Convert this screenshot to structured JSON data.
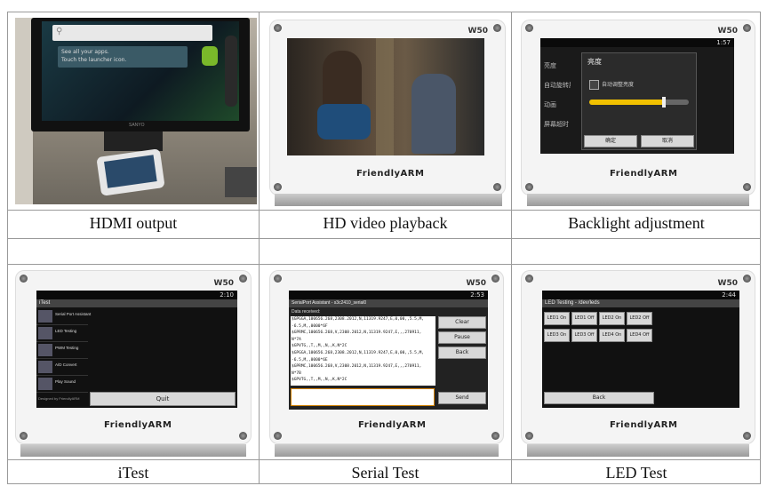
{
  "captions": [
    "HDMI output",
    "HD video playback",
    "Backlight adjustment",
    "iTest",
    "Serial Test",
    "LED Test"
  ],
  "board": {
    "brand": "FriendlyARM",
    "model": "W50"
  },
  "hdmi": {
    "search_text": "See all your apps.",
    "search_sub": "Touch the launcher icon.",
    "monitor_brand": "SANYO"
  },
  "backlight": {
    "time": "1:57",
    "dialog_title": "亮度",
    "auto_label": "自动调整亮度",
    "ok": "确定",
    "cancel": "取消",
    "brightness": 0.75,
    "menu": [
      "亮度",
      "自动旋转屏幕",
      "动画",
      "屏幕超时"
    ]
  },
  "itest": {
    "time": "2:10",
    "title": "iTest",
    "items": [
      "Serial Port Assistant",
      "LED Testing",
      "PWM Testing",
      "A/D Convert",
      "Play Sound"
    ],
    "footer": "Designed by FriendlyARM",
    "quit": "Quit"
  },
  "serial": {
    "time": "2:53",
    "title": "SerialPort Assistant - s3c2410_serial0",
    "received_label": "Data received:",
    "lines": [
      "$GPGGA,100656.268,2308.2012,N,11319.9247,E,0,00,,5.5,M,",
      "-6.5,M,,0000*6F",
      "$GPRMC,100656.268,V,2308.2012,N,11319.9247,E,,,270911,",
      "N*7A",
      "$GPVTG,,T,,M,,N,,K,N*2C",
      "$GPGGA,100656.268,2308.2012,N,11319.9247,E,0,00,,5.5,M,",
      "-6.5,M,,0000*6E",
      "$GPRMC,100656.268,V,2308.2012,N,11319.9247,E,,,270911,",
      "N*7B",
      "$GPVTG,,T,,M,,N,,K,N*2C"
    ],
    "buttons": [
      "Clear",
      "Pause",
      "Back"
    ],
    "send": "Send"
  },
  "led": {
    "time": "2:44",
    "title": "LED Testing - /dev/leds",
    "buttons": [
      "LED1 On",
      "LED1 Off",
      "LED2 On",
      "LED2 Off",
      "LED3 On",
      "LED3 Off",
      "LED4 On",
      "LED4 Off"
    ],
    "back": "Back"
  }
}
